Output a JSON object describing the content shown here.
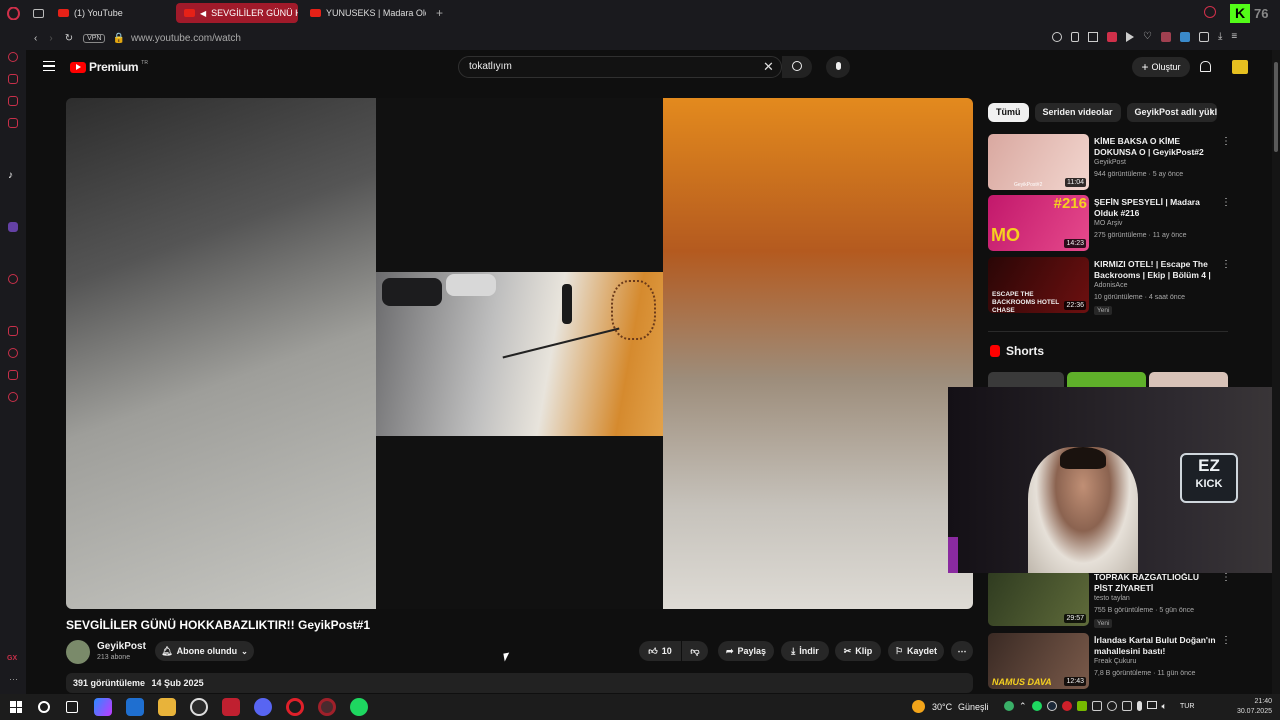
{
  "browser": {
    "tabs": [
      {
        "label": "(1) YouTube",
        "active": false
      },
      {
        "label": "SEVGİLİLER GÜNÜ HO",
        "active": true
      },
      {
        "label": "YUNUSEKS | Madara Old",
        "active": false
      }
    ],
    "vpn_label": "VPN",
    "url": "www.youtube.com/watch",
    "corner_badge": "76"
  },
  "youtube": {
    "logo_text": "Premium",
    "logo_sup": "TR",
    "search_value": "tokatlıyım",
    "create_label": "Oluştur"
  },
  "video": {
    "title": "SEVGİLİLER GÜNÜ HOKKABAZLIKTIR!! GeyikPost#1",
    "channel": "GeyikPost",
    "subscribers": "213 abone",
    "subscribe_label": "Abone olundu",
    "likes": "10",
    "share_label": "Paylaş",
    "download_label": "İndir",
    "clip_label": "Klip",
    "save_label": "Kaydet",
    "views": "391 görüntüleme",
    "date": "14 Şub 2025"
  },
  "chips": [
    "Tümü",
    "Seriden videolar",
    "GeyikPost adlı yükle"
  ],
  "recommendations": [
    {
      "title": "KİME BAKSA O KİME DOKUNSA O | GeyikPost#2",
      "channel": "GeyikPost",
      "meta": "944 görüntüleme · 5 ay önce",
      "duration": "11:04",
      "badge": "",
      "thumb_label": "GeyikPost#2",
      "color_a": "#d9a8a0",
      "color_b": "#f2d6cf"
    },
    {
      "title": "ŞEFİN SPESYELİ | Madara Olduk #216",
      "channel": "MO Arşiv",
      "meta": "275 görüntüleme · 11 ay önce",
      "duration": "14:23",
      "badge": "",
      "thumb_label": "#216",
      "color_a": "#c2186b",
      "color_b": "#e64a8c"
    },
    {
      "title": "KIRMIZI OTEL! | Escape The Backrooms | Ekip | Bölüm 4 |",
      "channel": "AdonisAce",
      "meta": "10 görüntüleme · 4 saat önce",
      "duration": "22:36",
      "badge": "Yeni",
      "thumb_label": "ESCAPE THE BACKROOMS HOTEL CHASE",
      "color_a": "#2a0606",
      "color_b": "#6d1010"
    },
    {
      "title": "TOPRAK RAZGATLIOĞLU PİST ZİYARETİ",
      "channel": "testo taylan",
      "meta": "755 B görüntüleme · 5 gün önce",
      "duration": "29:57",
      "badge": "Yeni",
      "thumb_label": "",
      "color_a": "#2f3b20",
      "color_b": "#5f6b3a"
    },
    {
      "title": "İrlandas Kartal Bulut Doğan'ın mahallesini bastı!",
      "channel": "Freak Çukuru",
      "meta": "7,8 B görüntüleme · 11 gün önce",
      "duration": "12:43",
      "badge": "",
      "thumb_label": "NAMUS DAVA",
      "color_a": "#3a2a24",
      "color_b": "#7a5a4a"
    }
  ],
  "shorts_label": "Shorts",
  "webcam": {
    "logo_top": "EZ",
    "logo_bottom": "KICK"
  },
  "taskbar": {
    "temperature": "30°C",
    "weather": "Güneşli",
    "language": "TUR",
    "time": "21:40",
    "date": "30.07.2025"
  }
}
